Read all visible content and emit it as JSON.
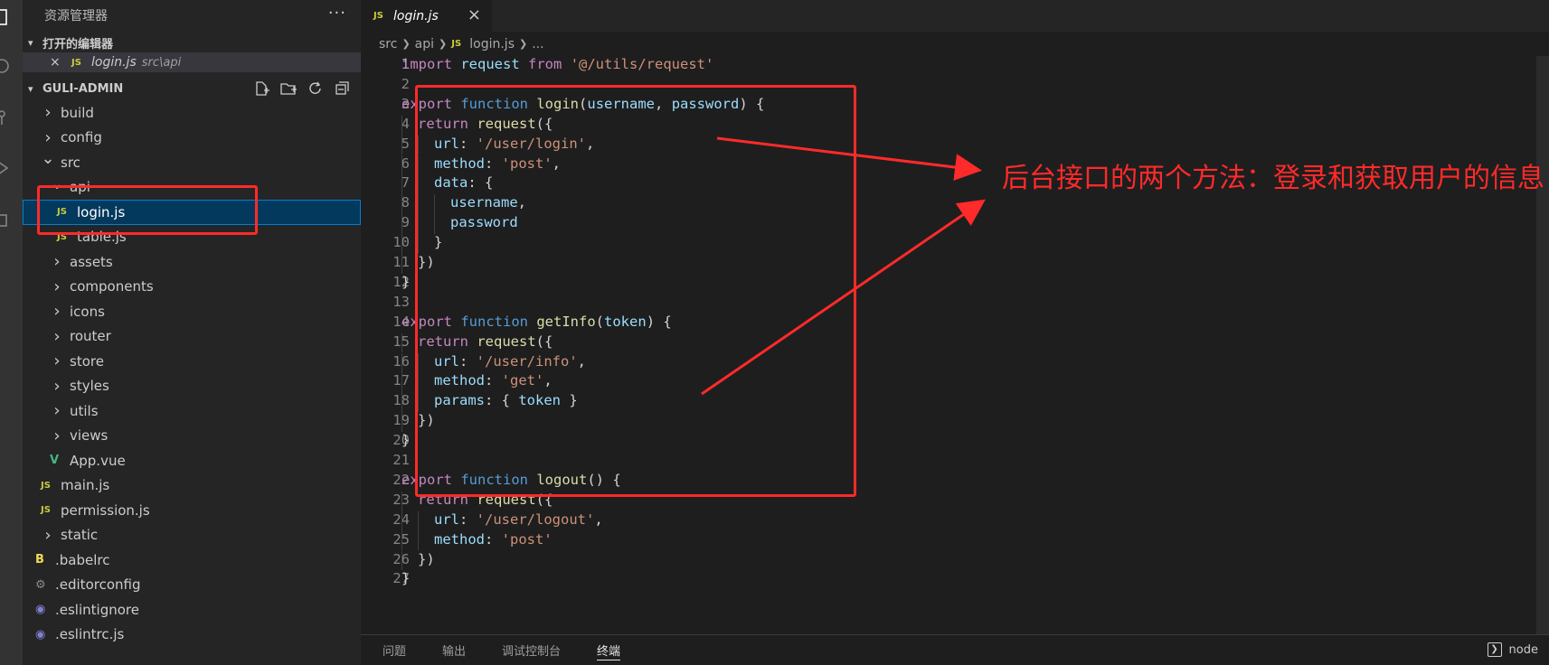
{
  "sidebar": {
    "title": "资源管理器",
    "more": "···",
    "open_editors": {
      "title": "打开的编辑器",
      "items": [
        {
          "close": "×",
          "badge": "JS",
          "name": "login.js",
          "path": "src\\api"
        }
      ]
    },
    "project": {
      "title": "GULI-ADMIN",
      "tree": [
        {
          "chevron": "›",
          "label": "build"
        },
        {
          "chevron": "›",
          "label": "config"
        },
        {
          "chevron": "⌄",
          "label": "src"
        },
        {
          "chevron": "⌄",
          "label": "api"
        },
        {
          "badge": "JS",
          "label": "login.js",
          "selected": true
        },
        {
          "badge": "JS",
          "label": "table.js"
        },
        {
          "chevron": "›",
          "label": "assets"
        },
        {
          "chevron": "›",
          "label": "components"
        },
        {
          "chevron": "›",
          "label": "icons"
        },
        {
          "chevron": "›",
          "label": "router"
        },
        {
          "chevron": "›",
          "label": "store"
        },
        {
          "chevron": "›",
          "label": "styles"
        },
        {
          "chevron": "›",
          "label": "utils"
        },
        {
          "chevron": "›",
          "label": "views"
        },
        {
          "badge": "V",
          "label": "App.vue"
        },
        {
          "badge": "JS",
          "label": "main.js"
        },
        {
          "badge": "JS",
          "label": "permission.js"
        },
        {
          "chevron": "›",
          "label": "static"
        },
        {
          "badge": "B",
          "label": ".babelrc"
        },
        {
          "badge": "⚙",
          "label": ".editorconfig"
        },
        {
          "badge": "◉",
          "label": ".eslintignore"
        },
        {
          "badge": "◉",
          "label": ".eslintrc.js"
        }
      ]
    }
  },
  "editor": {
    "tab": {
      "badge": "JS",
      "label": "login.js",
      "close": "×"
    },
    "breadcrumb": [
      "src",
      "api",
      "JS",
      "login.js",
      "..."
    ],
    "current_line": 1,
    "lines": [
      {
        "n": "1",
        "indent": 0,
        "tokens": [
          [
            "kw1",
            "import"
          ],
          [
            "pn",
            " "
          ],
          [
            "vr",
            "request"
          ],
          [
            "pn",
            " "
          ],
          [
            "kw1",
            "from"
          ],
          [
            "pn",
            " "
          ],
          [
            "st",
            "'@/utils/request'"
          ]
        ]
      },
      {
        "n": "2",
        "indent": 0,
        "tokens": []
      },
      {
        "n": "3",
        "indent": 0,
        "tokens": [
          [
            "kw1",
            "export"
          ],
          [
            "pn",
            " "
          ],
          [
            "kw2",
            "function"
          ],
          [
            "pn",
            " "
          ],
          [
            "fn",
            "login"
          ],
          [
            "pn",
            "("
          ],
          [
            "vr",
            "username"
          ],
          [
            "pn",
            ", "
          ],
          [
            "vr",
            "password"
          ],
          [
            "pn",
            ") {"
          ]
        ]
      },
      {
        "n": "4",
        "indent": 1,
        "tokens": [
          [
            "kw1",
            "return"
          ],
          [
            "pn",
            " "
          ],
          [
            "fn",
            "request"
          ],
          [
            "pn",
            "({"
          ]
        ]
      },
      {
        "n": "5",
        "indent": 2,
        "tokens": [
          [
            "vr",
            "url"
          ],
          [
            "pn",
            ": "
          ],
          [
            "st",
            "'/user/login'"
          ],
          [
            "pn",
            ","
          ]
        ]
      },
      {
        "n": "6",
        "indent": 2,
        "tokens": [
          [
            "vr",
            "method"
          ],
          [
            "pn",
            ": "
          ],
          [
            "st",
            "'post'"
          ],
          [
            "pn",
            ","
          ]
        ]
      },
      {
        "n": "7",
        "indent": 2,
        "tokens": [
          [
            "vr",
            "data"
          ],
          [
            "pn",
            ": {"
          ]
        ]
      },
      {
        "n": "8",
        "indent": 3,
        "tokens": [
          [
            "vr",
            "username"
          ],
          [
            "pn",
            ","
          ]
        ]
      },
      {
        "n": "9",
        "indent": 3,
        "tokens": [
          [
            "vr",
            "password"
          ]
        ]
      },
      {
        "n": "10",
        "indent": 2,
        "tokens": [
          [
            "pn",
            "}"
          ]
        ]
      },
      {
        "n": "11",
        "indent": 1,
        "tokens": [
          [
            "pn",
            "})"
          ]
        ]
      },
      {
        "n": "12",
        "indent": 0,
        "tokens": [
          [
            "pn",
            "}"
          ]
        ]
      },
      {
        "n": "13",
        "indent": 0,
        "tokens": []
      },
      {
        "n": "14",
        "indent": 0,
        "tokens": [
          [
            "kw1",
            "export"
          ],
          [
            "pn",
            " "
          ],
          [
            "kw2",
            "function"
          ],
          [
            "pn",
            " "
          ],
          [
            "fn",
            "getInfo"
          ],
          [
            "pn",
            "("
          ],
          [
            "vr",
            "token"
          ],
          [
            "pn",
            ") {"
          ]
        ]
      },
      {
        "n": "15",
        "indent": 1,
        "tokens": [
          [
            "kw1",
            "return"
          ],
          [
            "pn",
            " "
          ],
          [
            "fn",
            "request"
          ],
          [
            "pn",
            "({"
          ]
        ]
      },
      {
        "n": "16",
        "indent": 2,
        "tokens": [
          [
            "vr",
            "url"
          ],
          [
            "pn",
            ": "
          ],
          [
            "st",
            "'/user/info'"
          ],
          [
            "pn",
            ","
          ]
        ]
      },
      {
        "n": "17",
        "indent": 2,
        "tokens": [
          [
            "vr",
            "method"
          ],
          [
            "pn",
            ": "
          ],
          [
            "st",
            "'get'"
          ],
          [
            "pn",
            ","
          ]
        ]
      },
      {
        "n": "18",
        "indent": 2,
        "tokens": [
          [
            "vr",
            "params"
          ],
          [
            "pn",
            ": { "
          ],
          [
            "vr",
            "token"
          ],
          [
            "pn",
            " }"
          ]
        ]
      },
      {
        "n": "19",
        "indent": 1,
        "tokens": [
          [
            "pn",
            "})"
          ]
        ]
      },
      {
        "n": "20",
        "indent": 0,
        "tokens": [
          [
            "pn",
            "}"
          ]
        ]
      },
      {
        "n": "21",
        "indent": 0,
        "tokens": []
      },
      {
        "n": "22",
        "indent": 0,
        "tokens": [
          [
            "kw1",
            "export"
          ],
          [
            "pn",
            " "
          ],
          [
            "kw2",
            "function"
          ],
          [
            "pn",
            " "
          ],
          [
            "fn",
            "logout"
          ],
          [
            "pn",
            "() {"
          ]
        ]
      },
      {
        "n": "23",
        "indent": 1,
        "tokens": [
          [
            "kw1",
            "return"
          ],
          [
            "pn",
            " "
          ],
          [
            "fn",
            "request"
          ],
          [
            "pn",
            "({"
          ]
        ]
      },
      {
        "n": "24",
        "indent": 2,
        "tokens": [
          [
            "vr",
            "url"
          ],
          [
            "pn",
            ": "
          ],
          [
            "st",
            "'/user/logout'"
          ],
          [
            "pn",
            ","
          ]
        ]
      },
      {
        "n": "25",
        "indent": 2,
        "tokens": [
          [
            "vr",
            "method"
          ],
          [
            "pn",
            ": "
          ],
          [
            "st",
            "'post'"
          ]
        ]
      },
      {
        "n": "26",
        "indent": 1,
        "tokens": [
          [
            "pn",
            "})"
          ]
        ]
      },
      {
        "n": "27",
        "indent": 0,
        "tokens": [
          [
            "pn",
            "}"
          ]
        ]
      }
    ]
  },
  "panel": {
    "tabs": [
      "问题",
      "输出",
      "调试控制台",
      "终端"
    ],
    "active": "终端",
    "terminal_name": "node"
  },
  "annotation": {
    "text": "后台接口的两个方法：登录和获取用户的信息",
    "color": "#ff2a2a"
  },
  "colors": {
    "selection": "#04395e",
    "accent": "#007fd4",
    "js_badge": "#cbcb41",
    "vue_badge": "#41b883"
  }
}
